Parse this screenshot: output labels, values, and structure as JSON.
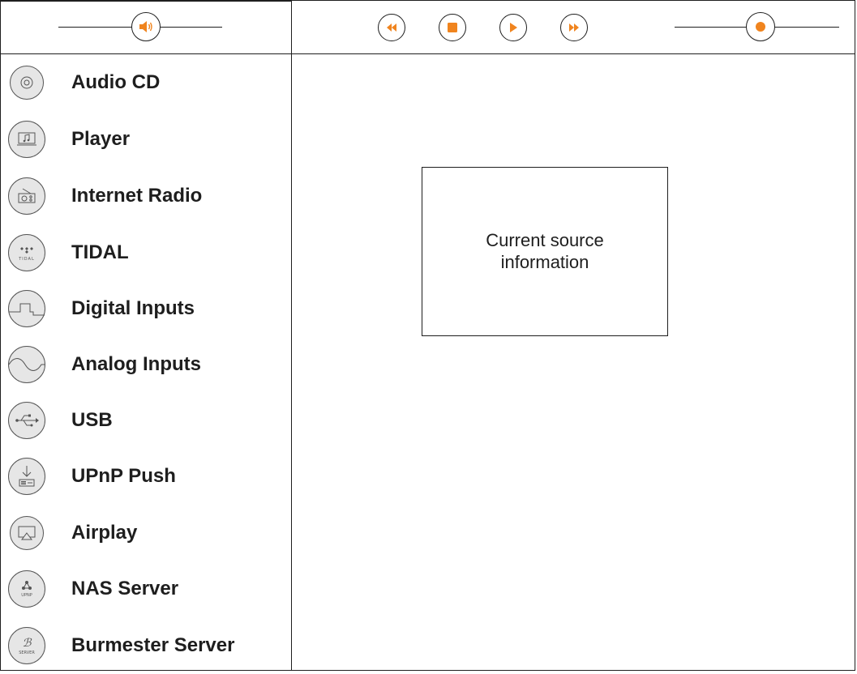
{
  "colors": {
    "accent": "#f0841e",
    "line": "#1e1e1e",
    "icon_bg": "#e6e6e6"
  },
  "topbar": {
    "volume_icon": "speaker-icon",
    "transport": [
      {
        "name": "rewind-button",
        "icon": "rewind-icon"
      },
      {
        "name": "stop-button",
        "icon": "stop-icon"
      },
      {
        "name": "play-button",
        "icon": "play-icon"
      },
      {
        "name": "fast-forward-button",
        "icon": "fast-forward-icon"
      }
    ],
    "position_icon": "record-dot-icon"
  },
  "sources": [
    {
      "label": "Audio CD",
      "icon": "cd-icon"
    },
    {
      "label": "Player",
      "icon": "player-icon"
    },
    {
      "label": "Internet Radio",
      "icon": "radio-icon"
    },
    {
      "label": "TIDAL",
      "icon": "tidal-icon",
      "icon_text": "TIDAL"
    },
    {
      "label": "Digital Inputs",
      "icon": "square-wave-icon"
    },
    {
      "label": "Analog Inputs",
      "icon": "sine-wave-icon"
    },
    {
      "label": "USB",
      "icon": "usb-icon"
    },
    {
      "label": "UPnP Push",
      "icon": "upnp-push-icon"
    },
    {
      "label": "Airplay",
      "icon": "airplay-icon"
    },
    {
      "label": "NAS Server",
      "icon": "upnp-icon",
      "icon_text": "UPNP"
    },
    {
      "label": "Burmester Server",
      "icon": "burmester-server-icon",
      "icon_text": "SERVER",
      "icon_glyph": "ℬ"
    }
  ],
  "main": {
    "info_text": "Current source information"
  }
}
